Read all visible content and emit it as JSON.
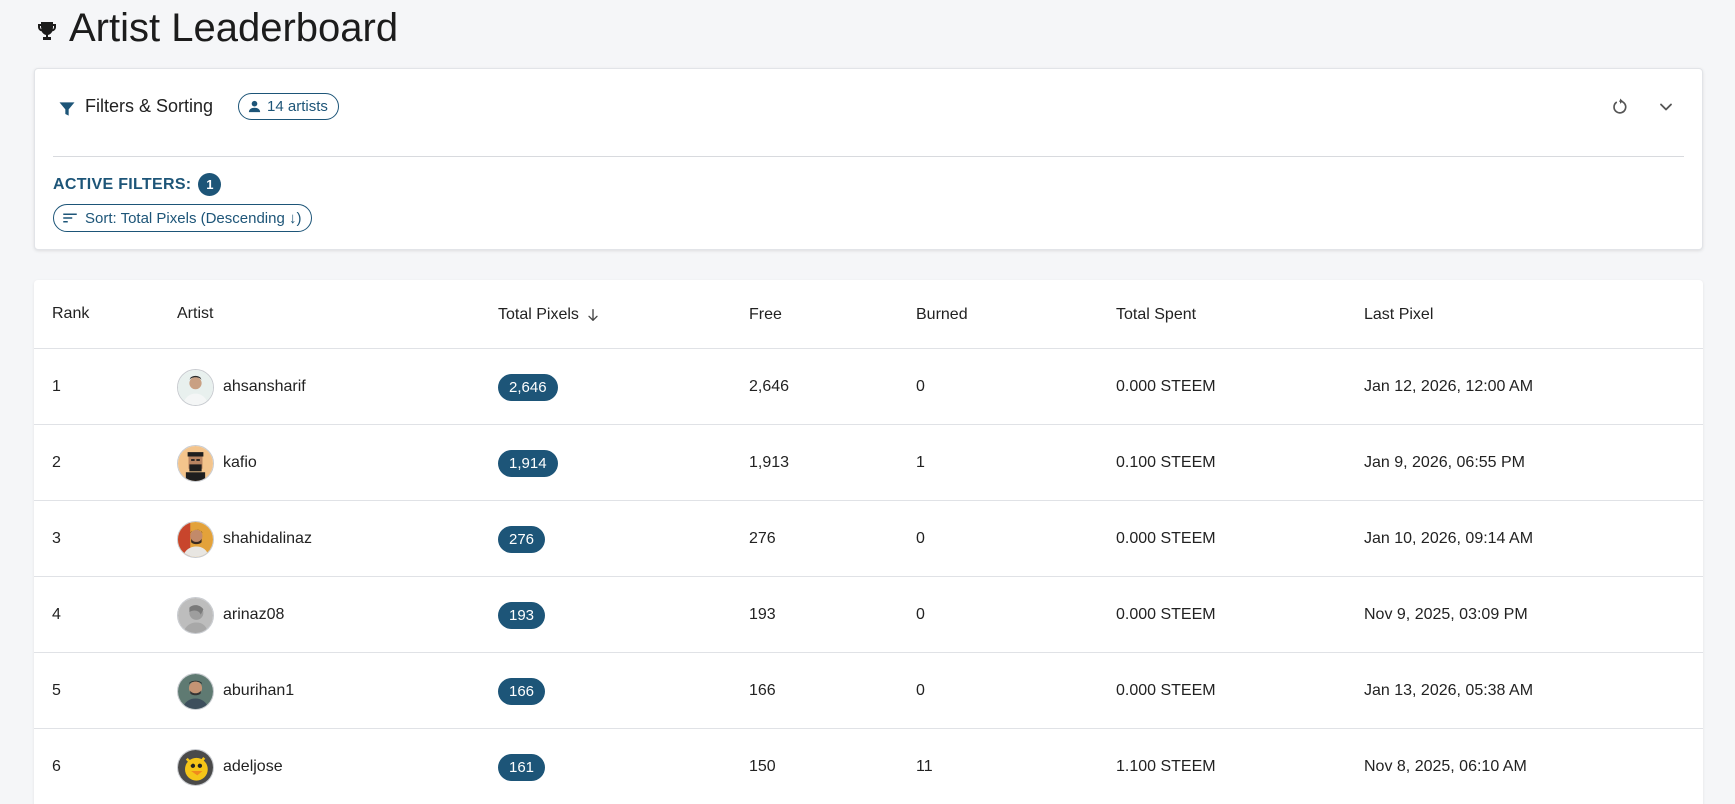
{
  "page": {
    "title": "Artist Leaderboard"
  },
  "filters": {
    "title": "Filters & Sorting",
    "artist_count": "14 artists",
    "active_label": "ACTIVE FILTERS:",
    "active_count": "1",
    "sort_chip": "Sort: Total Pixels (Descending ↓)"
  },
  "icons": {
    "title": "trophy-icon",
    "filter": "funnel-icon",
    "count": "person-icon",
    "reset": "refresh-icon",
    "collapse": "chevron-down-icon",
    "sort": "sort-lines-icon",
    "sorted_column": "arrow-down-icon"
  },
  "colors": {
    "accent": "#1d5578",
    "background": "#f5f6f8"
  },
  "table": {
    "headers": {
      "rank": "Rank",
      "artist": "Artist",
      "total": "Total Pixels",
      "free": "Free",
      "burned": "Burned",
      "spent": "Total Spent",
      "last": "Last Pixel"
    },
    "rows": [
      {
        "rank": "1",
        "artist": "ahsansharif",
        "total": "2,646",
        "free": "2,646",
        "burned": "0",
        "spent": "0.000 STEEM",
        "last": "Jan 12, 2026, 12:00 AM"
      },
      {
        "rank": "2",
        "artist": "kafio",
        "total": "1,914",
        "free": "1,913",
        "burned": "1",
        "spent": "0.100 STEEM",
        "last": "Jan 9, 2026, 06:55 PM"
      },
      {
        "rank": "3",
        "artist": "shahidalinaz",
        "total": "276",
        "free": "276",
        "burned": "0",
        "spent": "0.000 STEEM",
        "last": "Jan 10, 2026, 09:14 AM"
      },
      {
        "rank": "4",
        "artist": "arinaz08",
        "total": "193",
        "free": "193",
        "burned": "0",
        "spent": "0.000 STEEM",
        "last": "Nov 9, 2025, 03:09 PM"
      },
      {
        "rank": "5",
        "artist": "aburihan1",
        "total": "166",
        "free": "166",
        "burned": "0",
        "spent": "0.000 STEEM",
        "last": "Jan 13, 2026, 05:38 AM"
      },
      {
        "rank": "6",
        "artist": "adeljose",
        "total": "161",
        "free": "150",
        "burned": "11",
        "spent": "1.100 STEEM",
        "last": "Nov 8, 2025, 06:10 AM"
      }
    ]
  }
}
